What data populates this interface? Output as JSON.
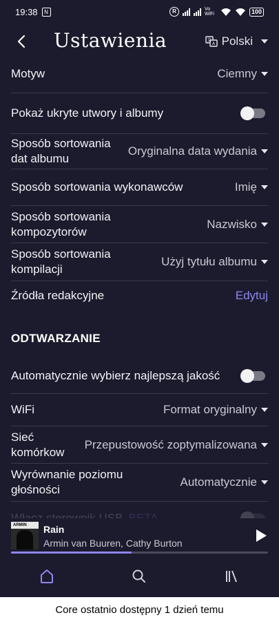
{
  "status_bar": {
    "time": "19:38",
    "nfc": "N",
    "r_badge": "R",
    "volte": "Vo WiFi",
    "battery": "100"
  },
  "header": {
    "title": "Ustawienia",
    "language": "Polski"
  },
  "settings": {
    "theme": {
      "label": "Motyw",
      "value": "Ciemny"
    },
    "hidden": {
      "label": "Pokaż ukryte utwory i albumy",
      "enabled": false
    },
    "album_date_sort": {
      "label_line1": "Sposób sortowania",
      "label_line2": "dat albumu",
      "value": "Oryginalna data wydania"
    },
    "artist_sort": {
      "label": "Sposób sortowania wykonawców",
      "value": "Imię"
    },
    "composer_sort": {
      "label_line1": "Sposób sortowania",
      "label_line2": "kompozytorów",
      "value": "Nazwisko"
    },
    "compilation_sort": {
      "label_line1": "Sposób sortowania",
      "label_line2": "kompilacji",
      "value": "Użyj tytułu albumu"
    },
    "editorial_sources": {
      "label": "Źródła redakcyjne",
      "action": "Edytuj"
    }
  },
  "playback": {
    "section_title": "ODTWARZANIE",
    "auto_quality": {
      "label": "Automatycznie wybierz najlepszą jakość",
      "enabled": false
    },
    "wifi": {
      "label": "WiFi",
      "value": "Format oryginalny"
    },
    "cellular": {
      "label_line1": "Sieć",
      "label_line2": "komórkow",
      "value": "Przepustowość zoptymalizowana"
    },
    "volume_leveling": {
      "label_line1": "Wyrównanie poziomu",
      "label_line2": "głośności",
      "value": "Automatycznie"
    },
    "usb_driver": {
      "label": "Włącz sterownik USB",
      "badge": "BETA"
    }
  },
  "player": {
    "album_text": "ARMIN",
    "title": "Rain",
    "artist": "Armin van Buuren, Cathy Burton",
    "progress": 0.47
  },
  "nav": {
    "items": [
      "home-icon",
      "search-icon",
      "library-icon"
    ],
    "active": "home-icon"
  },
  "footer": {
    "text": "Core ostatnio dostępny 1 dzień temu"
  },
  "colors": {
    "background": "#1b1b2d",
    "accent": "#8f86f0",
    "divider": "#3a3a4c"
  }
}
